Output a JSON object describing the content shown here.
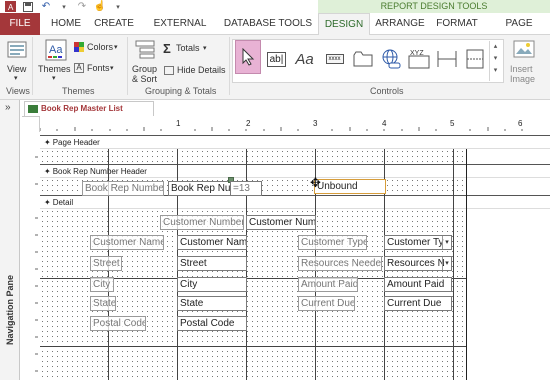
{
  "title_bar": {
    "context_tab_group": "REPORT DESIGN TOOLS"
  },
  "tabs": [
    {
      "label": "FILE"
    },
    {
      "label": "HOME"
    },
    {
      "label": "CREATE"
    },
    {
      "label": "EXTERNAL DATA"
    },
    {
      "label": "DATABASE TOOLS"
    },
    {
      "label": "DESIGN"
    },
    {
      "label": "ARRANGE"
    },
    {
      "label": "FORMAT"
    },
    {
      "label": "PAGE SETUP"
    }
  ],
  "ribbon": {
    "views": {
      "view_label": "View",
      "group_label": "Views"
    },
    "themes": {
      "themes_label": "Themes",
      "colors_label": "Colors",
      "fonts_label": "Fonts",
      "group_label": "Themes"
    },
    "grouping": {
      "group_sort_label": "Group & Sort",
      "totals_label": "Totals",
      "hide_details_label": "Hide Details",
      "group_label": "Grouping & Totals"
    },
    "controls": {
      "group_label": "Controls",
      "textbox_label": "ab|",
      "label_label": "Aa",
      "button_label": "xxxx"
    },
    "insert_image": {
      "label": "Insert Image"
    }
  },
  "document_tab": {
    "label": "Book Rep Master List"
  },
  "nav_pane": {
    "label": "Navigation Pane"
  },
  "ruler": {
    "marks": [
      "1",
      "2",
      "3",
      "4",
      "5",
      "6"
    ]
  },
  "sections": {
    "page_header": "Page Header",
    "group_header": "Book Rep Number Header",
    "detail": "Detail"
  },
  "group_header_controls": {
    "label": "Book Rep Number",
    "textbox": "Book Rep Num",
    "page_field": "=13",
    "unbound": "Unbound"
  },
  "detail_controls": {
    "customer_number_label": "Customer Number",
    "customer_number_field": "Customer Num",
    "customer_name_label": "Customer Name",
    "customer_name_field": "Customer Nam",
    "street_label": "Street",
    "street_field": "Street",
    "city_label": "City",
    "city_field": "City",
    "state_label": "State",
    "state_field": "State",
    "postal_code_label": "Postal Code",
    "postal_code_field": "Postal Code",
    "customer_type_label": "Customer Type",
    "customer_type_field": "Customer Ty",
    "resources_needed_label": "Resources Needed",
    "resources_needed_field": "Resources N",
    "amount_paid_label": "Amount Paid",
    "amount_paid_field": "Amount Paid",
    "current_due_label": "Current Due",
    "current_due_field": "Current Due"
  },
  "colors": {
    "accent": "#a4373a",
    "design_green": "#2e6b2b",
    "selection": "#d79d3a"
  }
}
